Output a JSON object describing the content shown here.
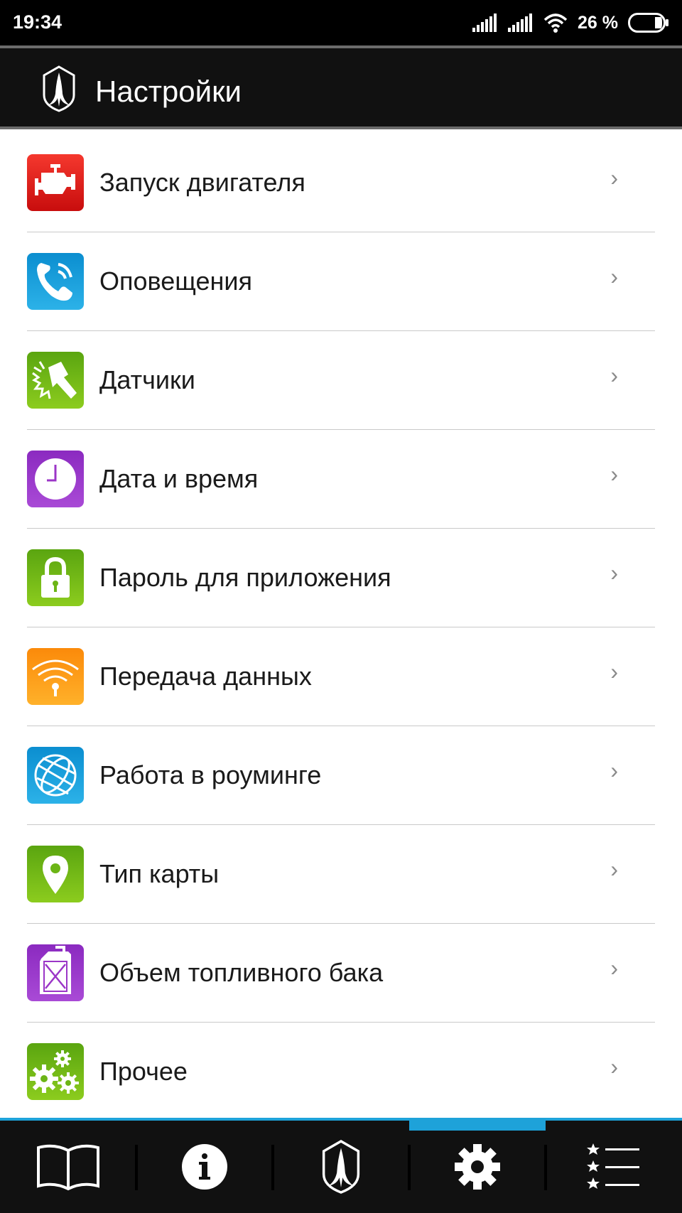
{
  "status_bar": {
    "time": "19:34",
    "battery": "26 %",
    "icons": [
      "signal-icon",
      "signal-icon",
      "wifi-icon",
      "battery-icon"
    ]
  },
  "app_bar": {
    "title": "Настройки",
    "logo": "brand-logo-icon"
  },
  "settings": {
    "items": [
      {
        "label": "Запуск двигателя",
        "icon": "engine-icon",
        "color": "#e8211c"
      },
      {
        "label": "Оповещения",
        "icon": "phone-icon",
        "color": "#1e9fd8"
      },
      {
        "label": "Датчики",
        "icon": "sensors-icon",
        "color": "#6cb516"
      },
      {
        "label": "Дата и время",
        "icon": "clock-icon",
        "color": "#9b36c7"
      },
      {
        "label": "Пароль для приложения",
        "icon": "lock-icon",
        "color": "#6cb516"
      },
      {
        "label": "Передача данных",
        "icon": "wifi-icon",
        "color": "#f89a14"
      },
      {
        "label": "Работа в роуминге",
        "icon": "globe-icon",
        "color": "#1e9fd8"
      },
      {
        "label": "Тип карты",
        "icon": "map-pin-icon",
        "color": "#6cb516"
      },
      {
        "label": "Объем топливного бака",
        "icon": "fuel-canister-icon",
        "color": "#9b36c7"
      },
      {
        "label": "Прочее",
        "icon": "gears-icon",
        "color": "#6cb516"
      }
    ],
    "chevron": "›"
  },
  "bottom_nav": {
    "items": [
      {
        "icon": "book-icon",
        "active": false
      },
      {
        "icon": "info-icon",
        "active": false
      },
      {
        "icon": "brand-logo-icon",
        "active": false
      },
      {
        "icon": "gear-icon",
        "active": true
      },
      {
        "icon": "favorites-list-icon",
        "active": false
      }
    ],
    "accent_color": "#1ea2d9"
  }
}
